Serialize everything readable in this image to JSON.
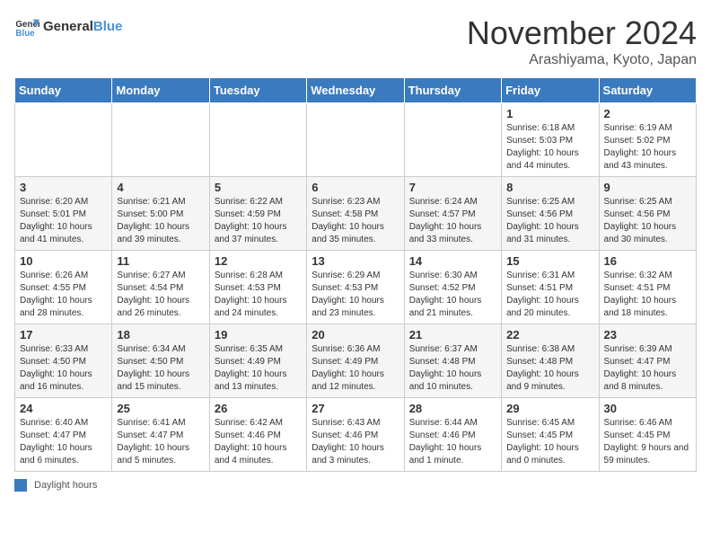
{
  "header": {
    "logo_text_general": "General",
    "logo_text_blue": "Blue",
    "month_title": "November 2024",
    "location": "Arashiyama, Kyoto, Japan"
  },
  "days_of_week": [
    "Sunday",
    "Monday",
    "Tuesday",
    "Wednesday",
    "Thursday",
    "Friday",
    "Saturday"
  ],
  "legend_label": "Daylight hours",
  "weeks": [
    {
      "days": [
        {
          "num": "",
          "info": ""
        },
        {
          "num": "",
          "info": ""
        },
        {
          "num": "",
          "info": ""
        },
        {
          "num": "",
          "info": ""
        },
        {
          "num": "",
          "info": ""
        },
        {
          "num": "1",
          "info": "Sunrise: 6:18 AM\nSunset: 5:03 PM\nDaylight: 10 hours and 44 minutes."
        },
        {
          "num": "2",
          "info": "Sunrise: 6:19 AM\nSunset: 5:02 PM\nDaylight: 10 hours and 43 minutes."
        }
      ]
    },
    {
      "days": [
        {
          "num": "3",
          "info": "Sunrise: 6:20 AM\nSunset: 5:01 PM\nDaylight: 10 hours and 41 minutes."
        },
        {
          "num": "4",
          "info": "Sunrise: 6:21 AM\nSunset: 5:00 PM\nDaylight: 10 hours and 39 minutes."
        },
        {
          "num": "5",
          "info": "Sunrise: 6:22 AM\nSunset: 4:59 PM\nDaylight: 10 hours and 37 minutes."
        },
        {
          "num": "6",
          "info": "Sunrise: 6:23 AM\nSunset: 4:58 PM\nDaylight: 10 hours and 35 minutes."
        },
        {
          "num": "7",
          "info": "Sunrise: 6:24 AM\nSunset: 4:57 PM\nDaylight: 10 hours and 33 minutes."
        },
        {
          "num": "8",
          "info": "Sunrise: 6:25 AM\nSunset: 4:56 PM\nDaylight: 10 hours and 31 minutes."
        },
        {
          "num": "9",
          "info": "Sunrise: 6:25 AM\nSunset: 4:56 PM\nDaylight: 10 hours and 30 minutes."
        }
      ]
    },
    {
      "days": [
        {
          "num": "10",
          "info": "Sunrise: 6:26 AM\nSunset: 4:55 PM\nDaylight: 10 hours and 28 minutes."
        },
        {
          "num": "11",
          "info": "Sunrise: 6:27 AM\nSunset: 4:54 PM\nDaylight: 10 hours and 26 minutes."
        },
        {
          "num": "12",
          "info": "Sunrise: 6:28 AM\nSunset: 4:53 PM\nDaylight: 10 hours and 24 minutes."
        },
        {
          "num": "13",
          "info": "Sunrise: 6:29 AM\nSunset: 4:53 PM\nDaylight: 10 hours and 23 minutes."
        },
        {
          "num": "14",
          "info": "Sunrise: 6:30 AM\nSunset: 4:52 PM\nDaylight: 10 hours and 21 minutes."
        },
        {
          "num": "15",
          "info": "Sunrise: 6:31 AM\nSunset: 4:51 PM\nDaylight: 10 hours and 20 minutes."
        },
        {
          "num": "16",
          "info": "Sunrise: 6:32 AM\nSunset: 4:51 PM\nDaylight: 10 hours and 18 minutes."
        }
      ]
    },
    {
      "days": [
        {
          "num": "17",
          "info": "Sunrise: 6:33 AM\nSunset: 4:50 PM\nDaylight: 10 hours and 16 minutes."
        },
        {
          "num": "18",
          "info": "Sunrise: 6:34 AM\nSunset: 4:50 PM\nDaylight: 10 hours and 15 minutes."
        },
        {
          "num": "19",
          "info": "Sunrise: 6:35 AM\nSunset: 4:49 PM\nDaylight: 10 hours and 13 minutes."
        },
        {
          "num": "20",
          "info": "Sunrise: 6:36 AM\nSunset: 4:49 PM\nDaylight: 10 hours and 12 minutes."
        },
        {
          "num": "21",
          "info": "Sunrise: 6:37 AM\nSunset: 4:48 PM\nDaylight: 10 hours and 10 minutes."
        },
        {
          "num": "22",
          "info": "Sunrise: 6:38 AM\nSunset: 4:48 PM\nDaylight: 10 hours and 9 minutes."
        },
        {
          "num": "23",
          "info": "Sunrise: 6:39 AM\nSunset: 4:47 PM\nDaylight: 10 hours and 8 minutes."
        }
      ]
    },
    {
      "days": [
        {
          "num": "24",
          "info": "Sunrise: 6:40 AM\nSunset: 4:47 PM\nDaylight: 10 hours and 6 minutes."
        },
        {
          "num": "25",
          "info": "Sunrise: 6:41 AM\nSunset: 4:47 PM\nDaylight: 10 hours and 5 minutes."
        },
        {
          "num": "26",
          "info": "Sunrise: 6:42 AM\nSunset: 4:46 PM\nDaylight: 10 hours and 4 minutes."
        },
        {
          "num": "27",
          "info": "Sunrise: 6:43 AM\nSunset: 4:46 PM\nDaylight: 10 hours and 3 minutes."
        },
        {
          "num": "28",
          "info": "Sunrise: 6:44 AM\nSunset: 4:46 PM\nDaylight: 10 hours and 1 minute."
        },
        {
          "num": "29",
          "info": "Sunrise: 6:45 AM\nSunset: 4:45 PM\nDaylight: 10 hours and 0 minutes."
        },
        {
          "num": "30",
          "info": "Sunrise: 6:46 AM\nSunset: 4:45 PM\nDaylight: 9 hours and 59 minutes."
        }
      ]
    }
  ]
}
